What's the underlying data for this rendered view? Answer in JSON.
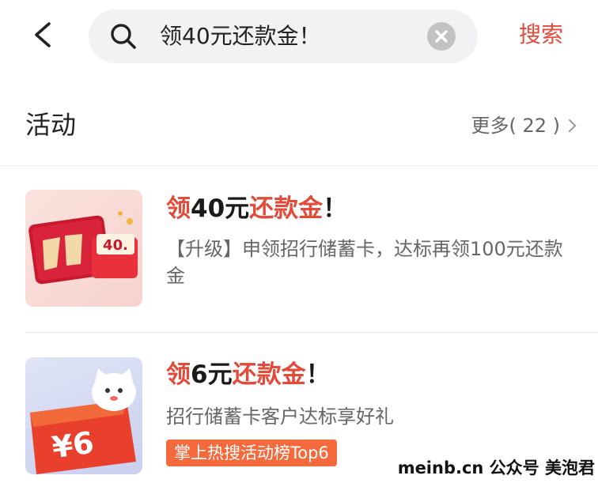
{
  "search": {
    "query": "领40元还款金！",
    "action_label": "搜索"
  },
  "section": {
    "title": "活动",
    "more_label": "更多",
    "more_count": "( 22 )"
  },
  "results": [
    {
      "title_parts": [
        "领",
        "40元",
        "还款金",
        "！"
      ],
      "description": "【升级】申领招行储蓄卡，达标再领100元还款金",
      "thumb_text": "40."
    },
    {
      "title_parts": [
        "领",
        "6元",
        "还款金",
        "！"
      ],
      "description": "招行储蓄卡客户达标享好礼",
      "badge": "掌上热搜活动榜Top6",
      "thumb_text": "¥6"
    }
  ],
  "watermark": "meinb.cn  公众号 美泡君",
  "colors": {
    "accent": "#e24a3a",
    "badge": "#f46a3c",
    "search_bg": "#f2f2f4"
  }
}
